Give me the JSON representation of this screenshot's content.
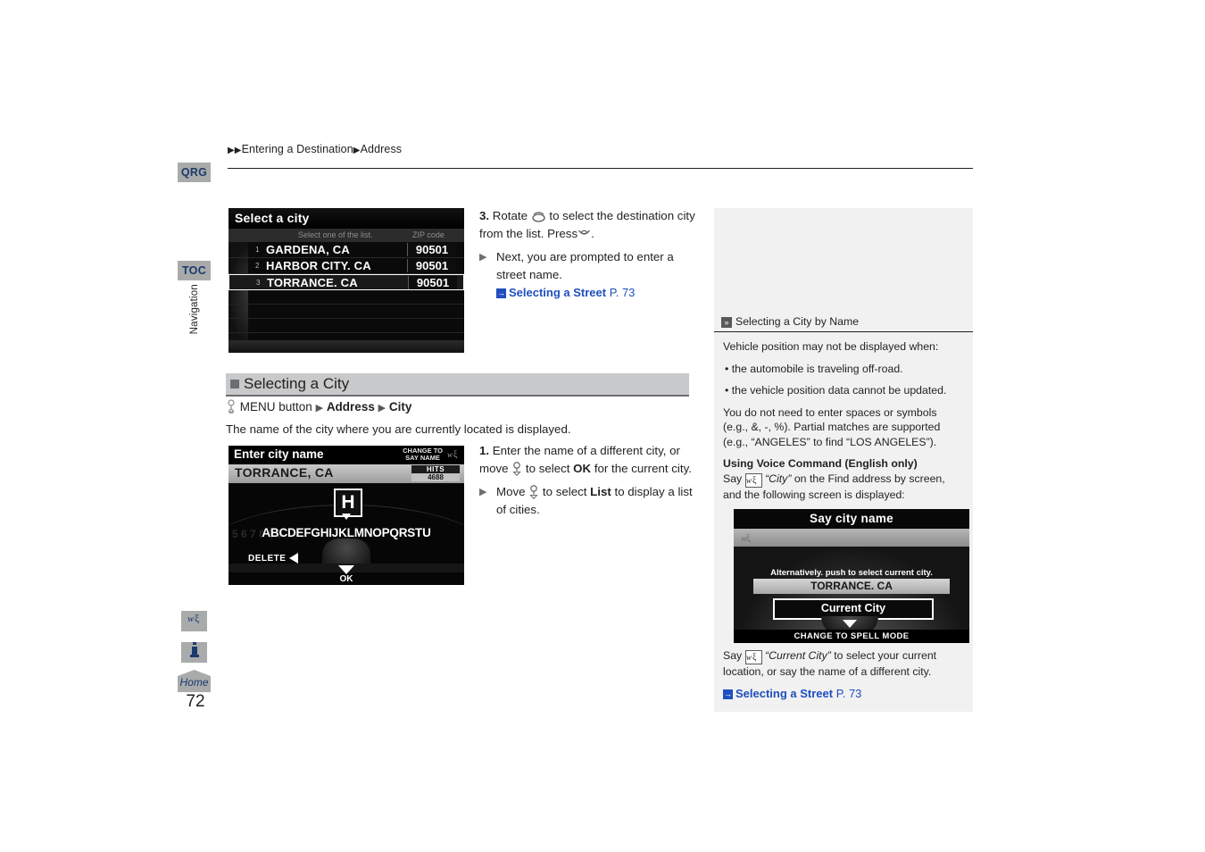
{
  "rail": {
    "qrg": "QRG",
    "toc": "TOC",
    "section_vertical": "Navigation",
    "voice_icon": "voice-command-icon",
    "info_icon": "information-icon",
    "home": "Home",
    "page_number": "72"
  },
  "header": {
    "breadcrumb_1": "Entering a Destination",
    "breadcrumb_2": "Address"
  },
  "select_city_screen": {
    "title": "Select a city",
    "sub_label": "Select one of the list.",
    "zip_label": "ZIP code",
    "rows": [
      {
        "index": "1",
        "name": "GARDENA, CA",
        "zip": "90501"
      },
      {
        "index": "2",
        "name": "HARBOR CITY. CA",
        "zip": "90501"
      },
      {
        "index": "3",
        "name": "TORRANCE. CA",
        "zip": "90501"
      }
    ]
  },
  "step3": {
    "number": "3.",
    "line1_a": "Rotate",
    "line1_b": "to select the destination city from the list. Press",
    "line1_c": ".",
    "sub_text": "Next, you are prompted to enter a street name.",
    "xref_label": "Selecting a Street",
    "xref_page": "P. 73"
  },
  "section": {
    "heading": "Selecting a City",
    "command_menu": "MENU button",
    "command_address": "Address",
    "command_city": "City",
    "description": "The name of the city where you are currently located is displayed."
  },
  "keyboard_screen": {
    "title": "Enter city name",
    "change_to": "CHANGE TO",
    "say_name": "SAY NAME",
    "value": "TORRANCE, CA",
    "hits_label": "HITS",
    "hits_count": "4688",
    "highlight_letter": "H",
    "letters": "ABCDEFGHIJKLMNOPQRSTU",
    "digits": "5 6 7 8 9 0",
    "delete_label": "DELETE",
    "ok_label": "OK"
  },
  "step1": {
    "number": "1.",
    "line_a": "Enter the name of a different city, or move",
    "line_b": "to select",
    "ok_bold": "OK",
    "line_c": "for the current city.",
    "sub_a": "Move",
    "sub_b": "to select",
    "list_bold": "List",
    "sub_c": "to display a list of cities."
  },
  "aside": {
    "heading": "Selecting a City by Name",
    "para_1": "Vehicle position may not be displayed when:",
    "bullet_1": "• the automobile is traveling off-road.",
    "bullet_2": "• the vehicle position data cannot be updated.",
    "para_2": "You do not need to enter spaces or symbols (e.g., &, -, %). Partial matches are supported (e.g., “ANGELES” to find “LOS ANGELES”).",
    "voice_heading": "Using Voice Command (English only)",
    "voice_say": "Say",
    "voice_quote": "“City”",
    "voice_rest": "on the Find address by screen, and the following screen is displayed:",
    "voice_screen": {
      "title": "Say city name",
      "alt_text": "Alternatively. push to select current city.",
      "city": "TORRANCE. CA",
      "button": "Current City",
      "spell_mode": "CHANGE TO SPELL MODE"
    },
    "closing_say": "Say",
    "closing_quote": "“Current City”",
    "closing_rest": "to select your current location, or say the name of a different city.",
    "closing_xref": "Selecting a Street",
    "closing_page": "P. 73"
  },
  "colors": {
    "link": "#1f4fbf",
    "chip_bg": "#a9abab",
    "chip_fg": "#1b3a6b",
    "section_bg": "#c8c9ca",
    "aside_bg": "#f1f1f1"
  }
}
